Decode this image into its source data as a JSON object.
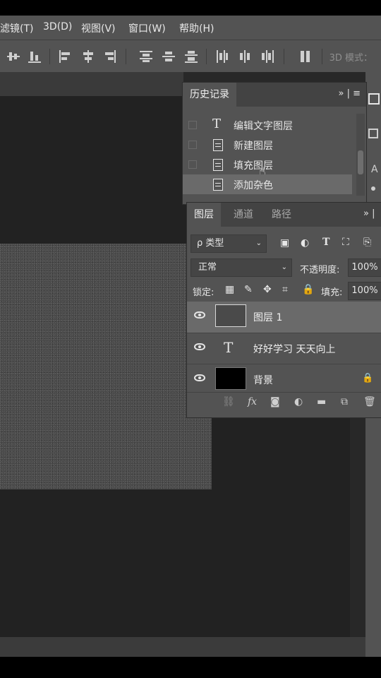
{
  "menubar": {
    "items": [
      "滤镜(T)",
      "3D(D)",
      "视图(V)",
      "窗口(W)",
      "帮助(H)"
    ]
  },
  "optionsbar": {
    "threed_label": "3D 模式："
  },
  "history": {
    "tab_label": "历史记录",
    "menu_glyph": "»  |  ≡",
    "items": [
      {
        "label": "编辑文字图层",
        "icon": "type-icon"
      },
      {
        "label": "新建图层",
        "icon": "document-icon"
      },
      {
        "label": "填充图层",
        "icon": "document-icon"
      },
      {
        "label": "添加杂色",
        "icon": "document-icon"
      }
    ],
    "selected_index": 3
  },
  "layers_panel": {
    "tabs": [
      "图层",
      "通道",
      "路径"
    ],
    "menu_glyph": "»  |",
    "filter_label": "ρ 类型",
    "blend_mode": "正常",
    "opacity_label": "不透明度:",
    "opacity_value": "100%",
    "lock_label": "锁定:",
    "fill_label": "填充:",
    "fill_value": "100%",
    "layers": [
      {
        "name": "图层 1",
        "type": "noise"
      },
      {
        "name": "好好学习 天天向上",
        "type": "text"
      },
      {
        "name": "背景",
        "type": "background",
        "locked": true
      }
    ],
    "footer_icons": [
      "link-icon",
      "fx-icon",
      "mask-icon",
      "adjustment-icon",
      "folder-icon",
      "new-layer-icon",
      "trash-icon"
    ],
    "footer_glyphs": {
      "fx": "fx"
    }
  },
  "colors": {
    "panel_bg": "#535353",
    "selected_row": "#6a6a6a",
    "canvas_bg": "#222222"
  }
}
